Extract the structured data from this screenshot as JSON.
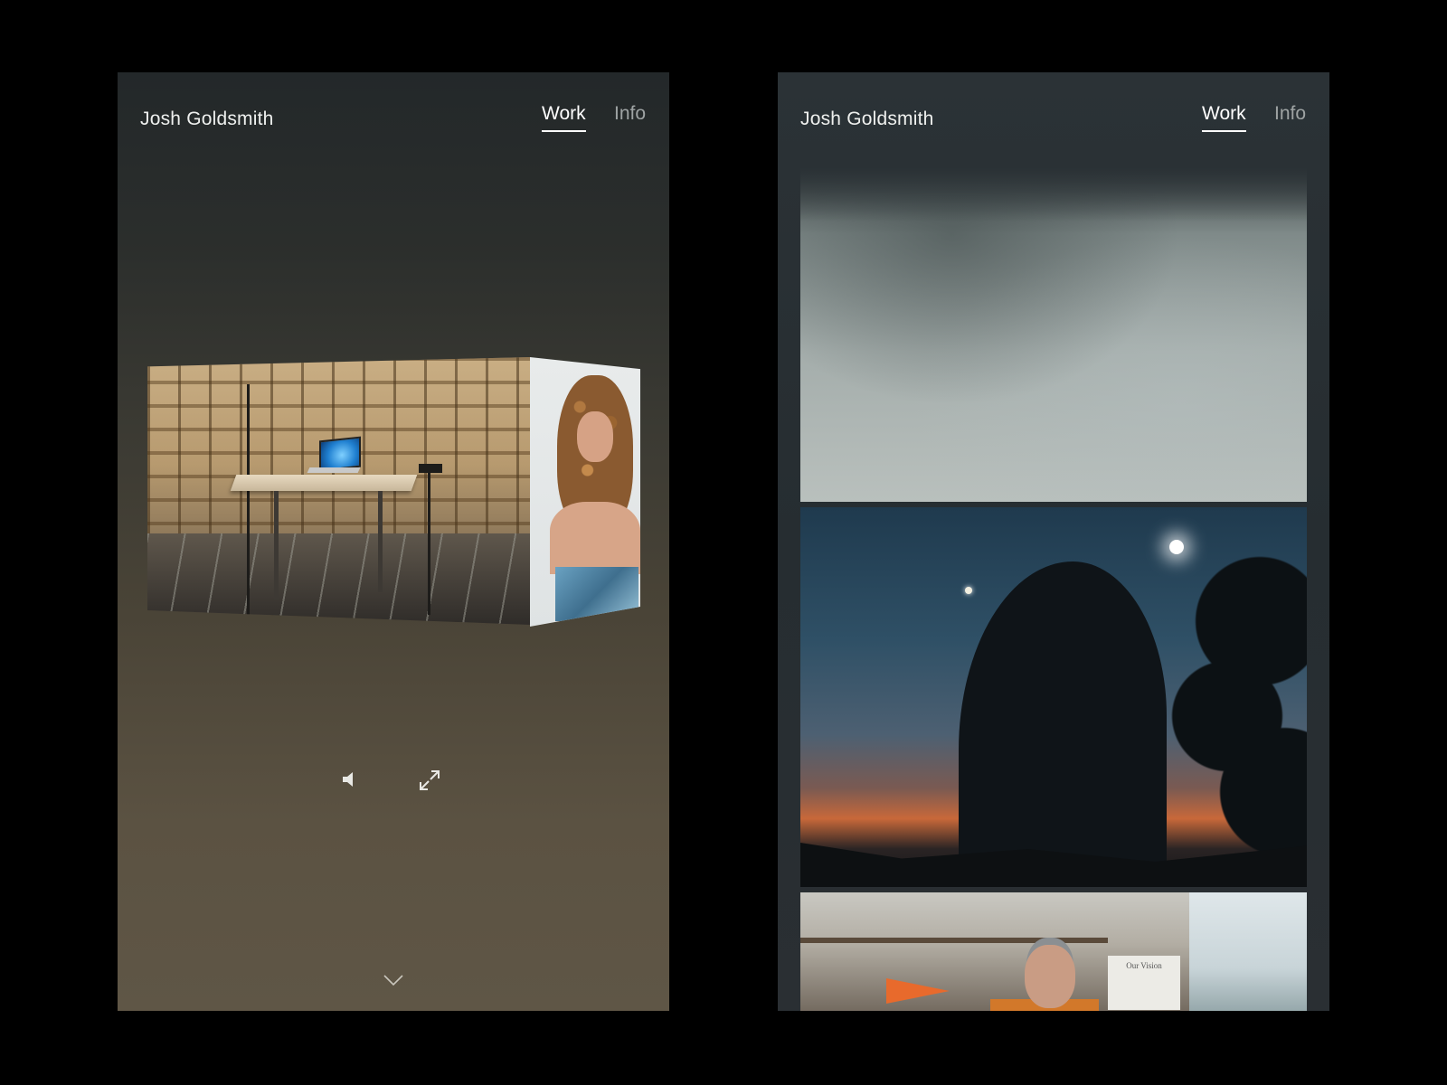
{
  "left_screen": {
    "site_title": "Josh Goldsmith",
    "nav": [
      {
        "label": "Work",
        "active": true
      },
      {
        "label": "Info",
        "active": false
      }
    ],
    "controls": {
      "mute_icon": "speaker-muted-icon",
      "fullscreen_icon": "expand-icon",
      "scroll_icon": "chevron-down-icon"
    }
  },
  "right_screen": {
    "site_title": "Josh Goldsmith",
    "nav": [
      {
        "label": "Work",
        "active": true
      },
      {
        "label": "Info",
        "active": false
      }
    ],
    "thumbnails": [
      {
        "subject": "cloudy sky"
      },
      {
        "subject": "silhouette runner at dusk"
      },
      {
        "subject": "office scene",
        "poster_text": "Our Vision"
      }
    ]
  },
  "colors": {
    "nav_active": "#ffffff",
    "nav_inactive": "#9ea3a3"
  }
}
